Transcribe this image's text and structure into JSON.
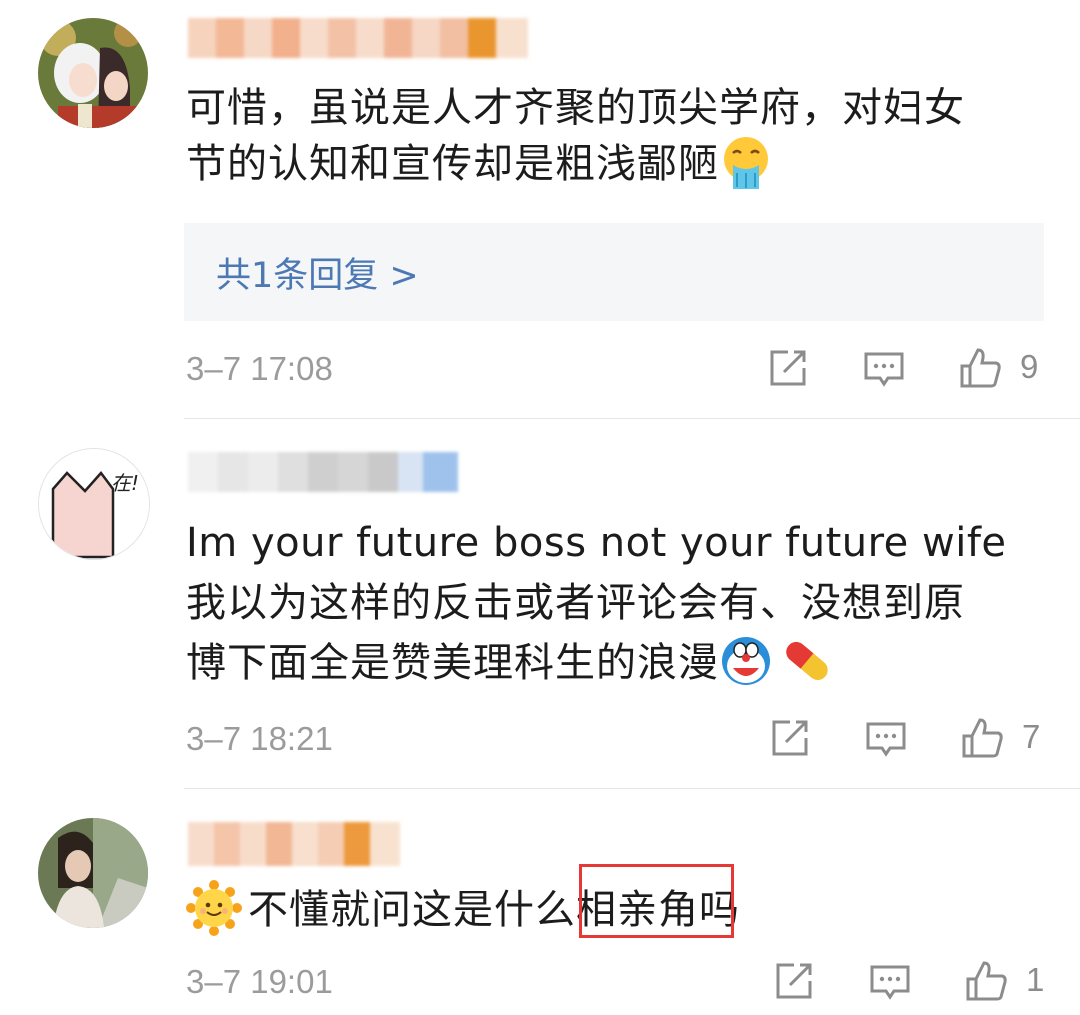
{
  "comments": [
    {
      "lines": [
        "可惜，虽说是人才齐聚的顶尖学府，对妇女",
        "节的认知和宣传却是粗浅鄙陋"
      ],
      "emoji": "vomiting-face-icon",
      "reply_link": "共1条回复 >",
      "time": "3–7 17:08",
      "likes": "9"
    },
    {
      "lines": [
        "Im your future boss not your future wife",
        "我以为这样的反击或者评论会有、没想到原",
        "博下面全是赞美理科生的浪漫"
      ],
      "emoji": "doraemon-icon, pill-icon",
      "avatar_text": "在!",
      "time": "3–7 18:21",
      "likes": "7"
    },
    {
      "lines": [
        "不懂就问这是什么相亲角吗"
      ],
      "emoji": "sun-face-icon",
      "time": "3–7 19:01",
      "likes": "1"
    }
  ],
  "colors": {
    "link": "#4c78b4",
    "meta": "#9b9b9b",
    "highlight": "#e53935",
    "reply_bg": "#f5f6f8"
  }
}
